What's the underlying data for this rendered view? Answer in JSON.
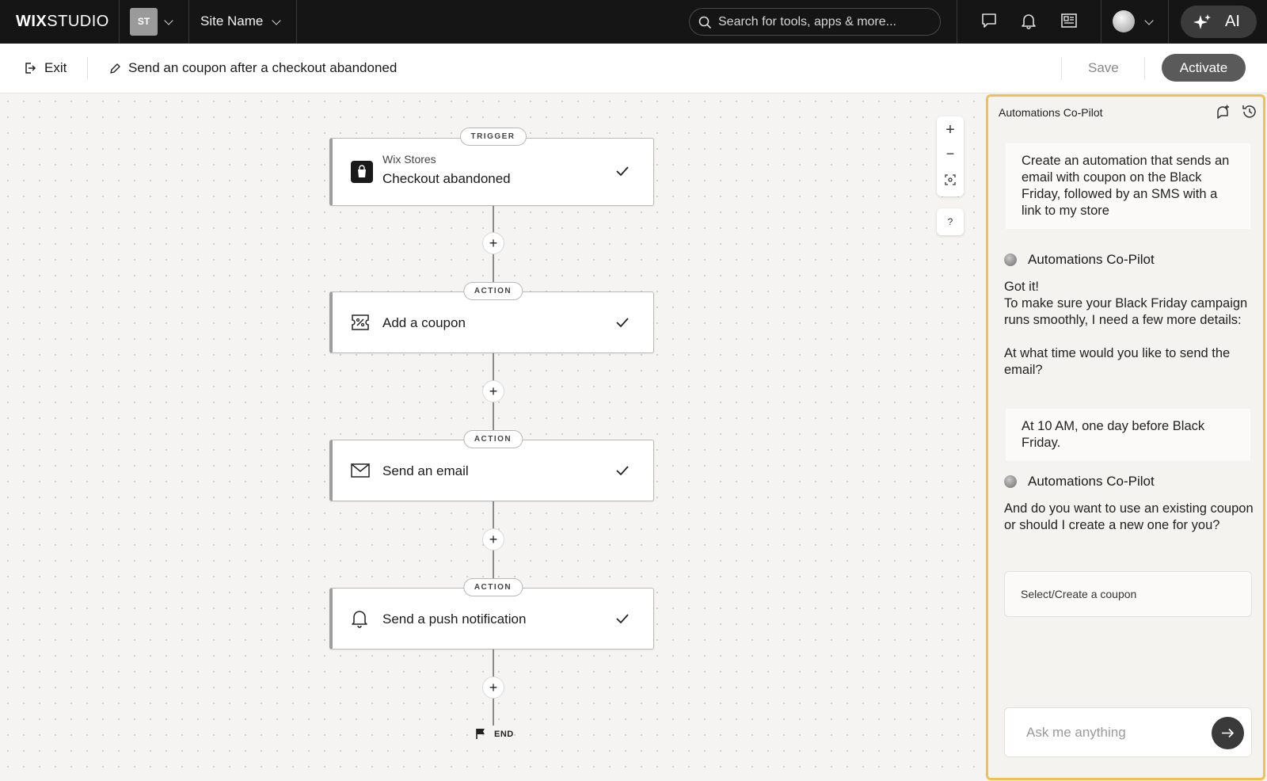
{
  "topbar": {
    "logo_bold": "WIX",
    "logo_light": "STUDIO",
    "site_initials": "ST",
    "site_name": "Site Name",
    "search_placeholder": "Search for tools, apps & more...",
    "ai_label": "AI"
  },
  "subbar": {
    "exit_label": "Exit",
    "automation_name": "Send an coupon after a checkout abandoned",
    "save_label": "Save",
    "activate_label": "Activate"
  },
  "flow": {
    "trigger": {
      "pill": "TRIGGER",
      "source": "Wix Stores",
      "title": "Checkout abandoned"
    },
    "actions": [
      {
        "pill": "ACTION",
        "title": "Add a coupon",
        "icon": "coupon-icon"
      },
      {
        "pill": "ACTION",
        "title": "Send an email",
        "icon": "envelope-icon"
      },
      {
        "pill": "ACTION",
        "title": "Send a push notification",
        "icon": "bell-icon"
      }
    ],
    "add_step_symbol": "+",
    "end_label": "END"
  },
  "canvas_controls": {
    "zoom_in": "+",
    "zoom_out": "−",
    "help": "?"
  },
  "copilot": {
    "title": "Automations Co-Pilot",
    "user_message_1": "Create an automation that sends an email with coupon on the Black Friday, followed by an SMS with a link to my store",
    "bot_name": "Automations Co-Pilot",
    "bot_message_1_line1": "Got it!",
    "bot_message_1_line2": "To make sure your Black Friday campaign runs smoothly, I need a few more details:",
    "bot_message_1_line3": "At what time would you like to send the email?",
    "user_message_2": "At 10 AM, one day before Black Friday.",
    "bot_message_2": "And do you want to use an existing coupon or should I create a new one for you?",
    "select_coupon_label": "Select/Create a coupon",
    "input_placeholder": "Ask me anything"
  },
  "colors": {
    "topbar_bg": "#151515",
    "panel_border": "#f2c052",
    "activate_bg": "#5a5a5a"
  }
}
